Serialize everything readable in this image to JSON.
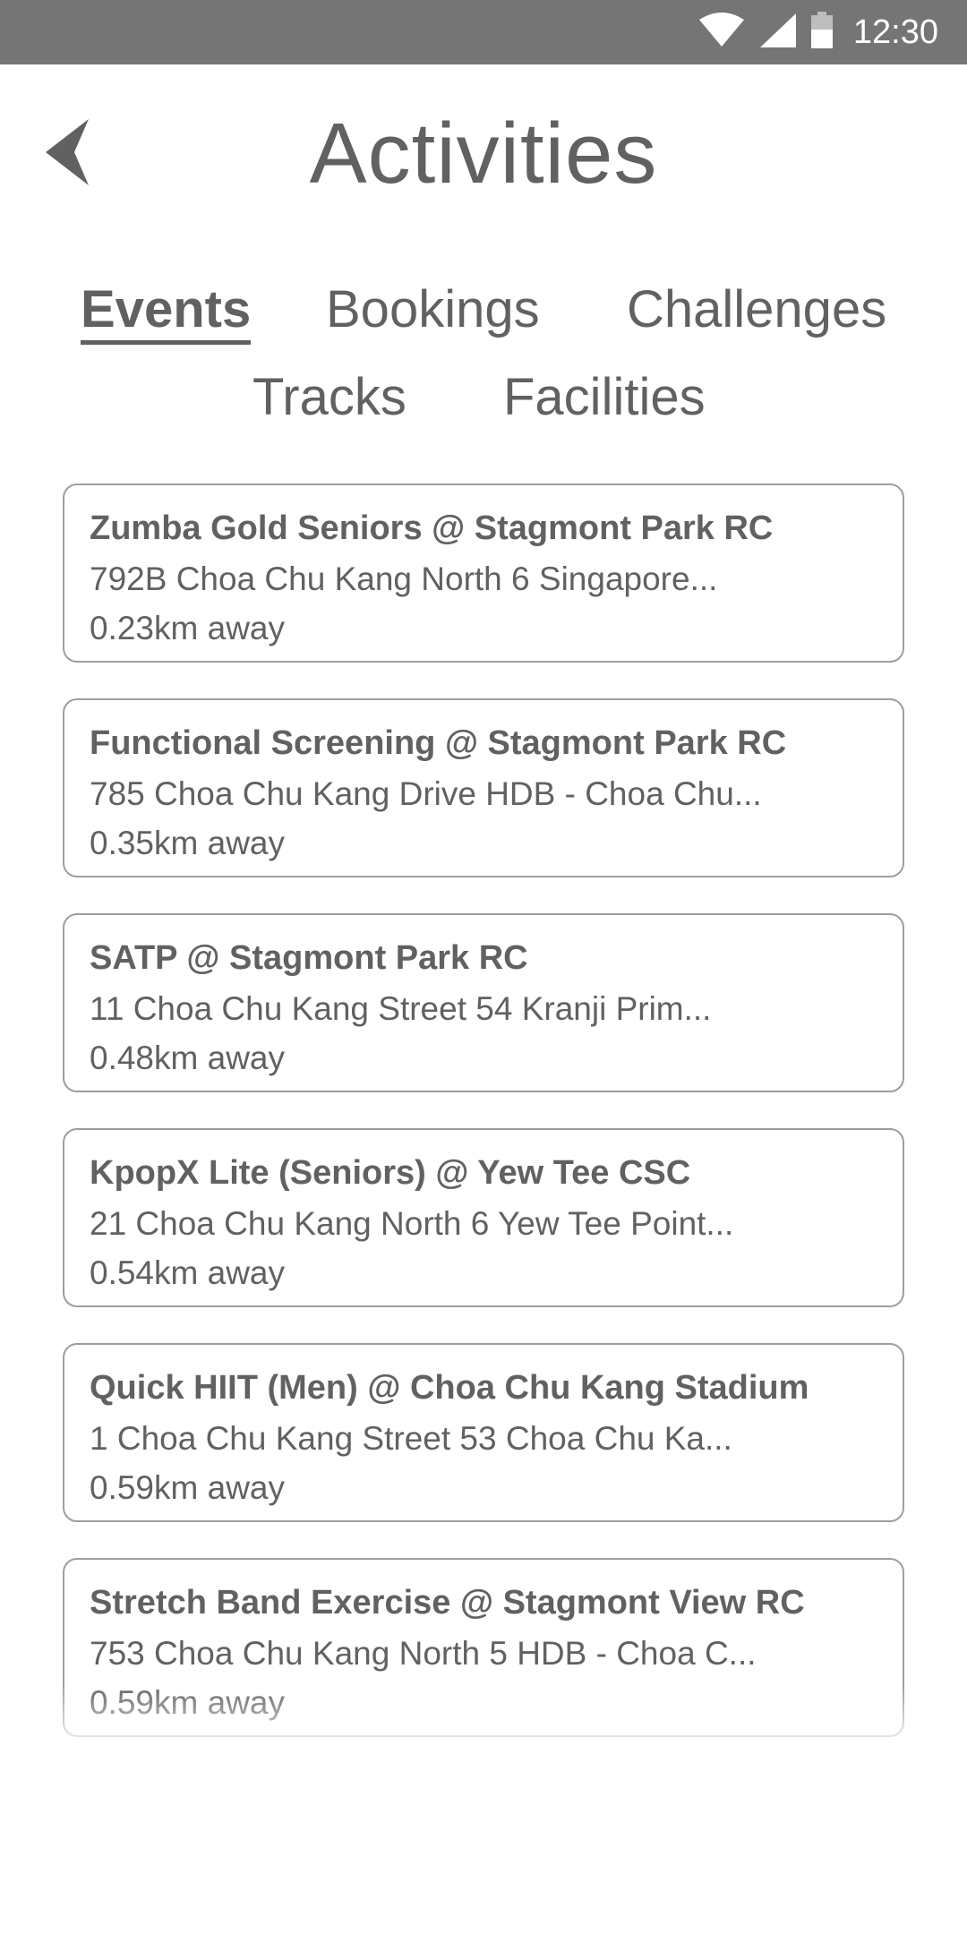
{
  "status_bar": {
    "time": "12:30",
    "icons": [
      "wifi-icon",
      "signal-icon",
      "battery-icon"
    ]
  },
  "header": {
    "back_icon": "chevron-left-icon",
    "title": "Activities"
  },
  "tabs": [
    {
      "label": "Events",
      "active": true
    },
    {
      "label": "Bookings",
      "active": false
    },
    {
      "label": "Challenges",
      "active": false
    },
    {
      "label": "Tracks",
      "active": false
    },
    {
      "label": "Facilities",
      "active": false
    }
  ],
  "events": [
    {
      "title": "Zumba Gold Seniors @ Stagmont Park RC",
      "address": "792B Choa Chu Kang North 6 Singapore...",
      "distance": "0.23km away"
    },
    {
      "title": "Functional Screening @ Stagmont Park RC",
      "address": "785 Choa Chu Kang Drive HDB - Choa Chu...",
      "distance": "0.35km away"
    },
    {
      "title": "SATP @ Stagmont Park RC",
      "address": "11 Choa Chu Kang Street 54 Kranji Prim...",
      "distance": "0.48km away"
    },
    {
      "title": "KpopX Lite (Seniors) @ Yew Tee CSC",
      "address": "21 Choa Chu Kang North 6 Yew Tee Point...",
      "distance": "0.54km away"
    },
    {
      "title": "Quick HIIT (Men) @ Choa Chu Kang Stadium",
      "address": "1 Choa Chu Kang Street 53 Choa Chu Ka...",
      "distance": "0.59km away"
    },
    {
      "title": "Stretch Band Exercise @ Stagmont View RC",
      "address": "753 Choa Chu Kang North 5 HDB - Choa C...",
      "distance": "0.59km away"
    }
  ],
  "colors": {
    "status_bar": "#757575",
    "text": "#616161",
    "card_border": "#9e9e9e",
    "background": "#ffffff"
  }
}
